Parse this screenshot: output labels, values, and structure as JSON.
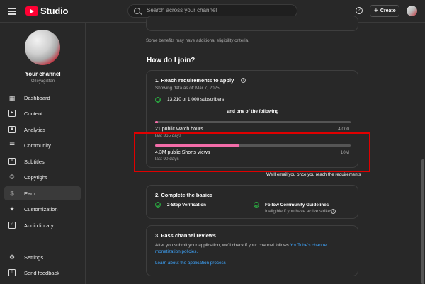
{
  "header": {
    "app_name": "Studio",
    "search_placeholder": "Search across your channel",
    "create_label": "Create"
  },
  "sidebar": {
    "channel_title": "Your channel",
    "channel_handle": "Ozeyagizfan",
    "items": [
      {
        "label": "Dashboard"
      },
      {
        "label": "Content"
      },
      {
        "label": "Analytics"
      },
      {
        "label": "Community"
      },
      {
        "label": "Subtitles"
      },
      {
        "label": "Copyright"
      },
      {
        "label": "Earn"
      },
      {
        "label": "Customization"
      },
      {
        "label": "Audio library"
      },
      {
        "label": "Settings"
      },
      {
        "label": "Send feedback"
      }
    ],
    "active_item": "Earn"
  },
  "main": {
    "eligibility_note": "Some benefits may have additional eligibility criteria.",
    "heading": "How do I join?",
    "step1": {
      "title": "1. Reach requirements to apply",
      "data_as_of": "Showing data as of: Mar 7, 2025",
      "subscribers": "13,210 of 1,000 subscribers",
      "one_of": "and one of the following",
      "watch_hours_label": "21 public watch hours",
      "watch_hours_period": "last 365 days",
      "watch_hours_goal": "4,000",
      "watch_hours_progress": 0.005,
      "shorts_label": "4.3M public Shorts views",
      "shorts_period": "last 90 days",
      "shorts_goal": "10M",
      "shorts_progress": 0.43
    },
    "email_note": "We'll email you once you reach the requirements",
    "step2": {
      "title": "2. Complete the basics",
      "item1": "2-Step Verification",
      "item2": "Follow Community Guidelines",
      "item2_note": "Ineligible if you have active strikes"
    },
    "step3": {
      "title": "3. Pass channel reviews",
      "text": "After you submit your application, we'll check if your channel follows ",
      "link_text": "YouTube's channel monetization policies.",
      "learn_link": "Learn about the application process"
    }
  },
  "colors": {
    "progress": "#f36ca8",
    "check": "#2ba640",
    "highlight": "#e00000",
    "link": "#3ea6ff"
  }
}
